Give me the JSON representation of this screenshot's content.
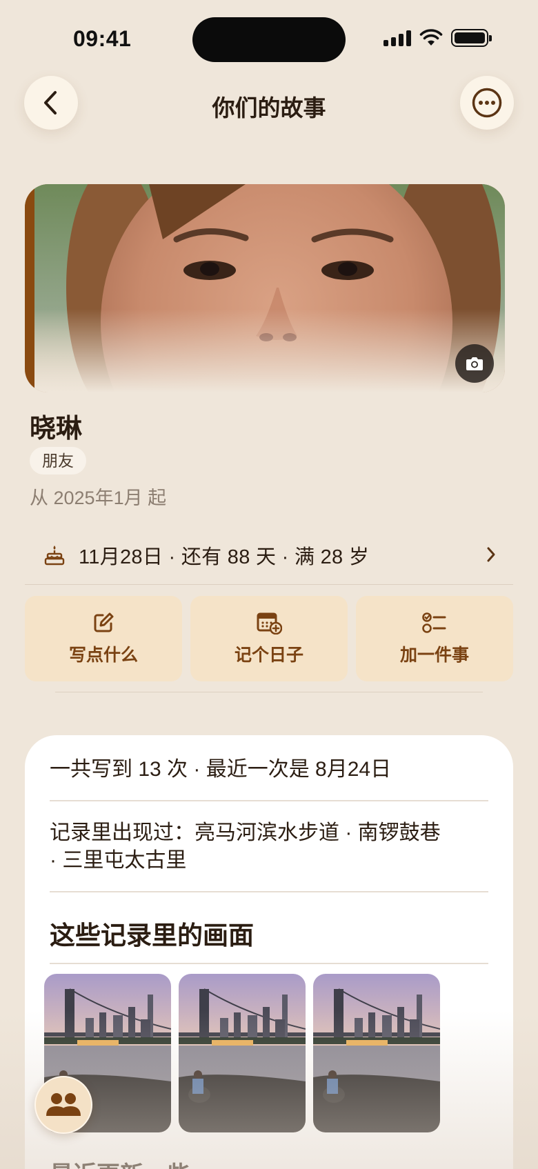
{
  "status_bar": {
    "time": "09:41"
  },
  "nav": {
    "title": "你们的故事"
  },
  "profile": {
    "name": "晓琳",
    "relationship_tag": "朋友",
    "since": "从 2025年1月 起",
    "birthday_summary": "11月28日 · 还有 88 天 · 满 28 岁"
  },
  "actions": [
    {
      "label": "写点什么",
      "icon": "edit-icon"
    },
    {
      "label": "记个日子",
      "icon": "calendar-add-icon"
    },
    {
      "label": "加一件事",
      "icon": "checklist-icon"
    }
  ],
  "stats": {
    "count_line": "一共写到 13 次 · 最近一次是 8月24日",
    "places_line_1": "记录里出现过：亮马河滨水步道 · 南锣鼓巷",
    "places_line_2": "· 三里屯太古里",
    "photos_title": "这些记录里的画面",
    "next_title_partial": "最近更新一些"
  },
  "colors": {
    "background": "#efe6da",
    "accent": "#7a4212",
    "action_bg": "#f5e3c8",
    "card_bg": "#ffffff"
  }
}
